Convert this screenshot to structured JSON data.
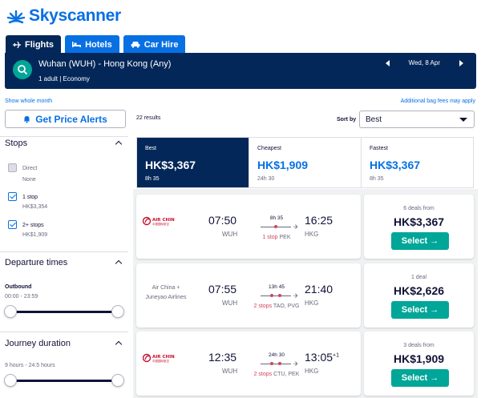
{
  "brand": {
    "name": "Skyscanner",
    "color": "#0770e3"
  },
  "tabs": [
    {
      "label": "Flights",
      "icon": "plane-icon",
      "active": true
    },
    {
      "label": "Hotels",
      "icon": "bed-icon",
      "active": false
    },
    {
      "label": "Car Hire",
      "icon": "car-icon",
      "active": false
    }
  ],
  "search": {
    "route": "Wuhan (WUH) - Hong Kong (Any)",
    "travellers": "1 adult | Economy",
    "date": "Wed, 8 Apr"
  },
  "links": {
    "show_month": "Show whole month",
    "bag_fees": "Additional bag fees may apply"
  },
  "price_alert": {
    "label": "Get Price Alerts",
    "icon": "bell-icon"
  },
  "filters": {
    "stops": {
      "title": "Stops",
      "options": [
        {
          "label": "Direct",
          "price": "None",
          "checked": false,
          "disabled": true
        },
        {
          "label": "1 stop",
          "price": "HK$3,354",
          "checked": true,
          "disabled": false
        },
        {
          "label": "2+ stops",
          "price": "HK$1,909",
          "checked": true,
          "disabled": false
        }
      ]
    },
    "departure": {
      "title": "Departure times",
      "subtitle": "Outbound",
      "range": "00:00 - 23:59"
    },
    "duration": {
      "title": "Journey duration",
      "range": "9 hours - 24.5 hours"
    }
  },
  "results": {
    "count": "22 results",
    "sort_label": "Sort by",
    "sort_value": "Best"
  },
  "sort_tabs": [
    {
      "label": "Best",
      "price": "HK$3,367",
      "duration": "8h 35",
      "active": true
    },
    {
      "label": "Cheapest",
      "price": "HK$1,909",
      "duration": "24h 30",
      "active": false
    },
    {
      "label": "Fastest",
      "price": "HK$3,367",
      "duration": "8h 35",
      "active": false
    }
  ],
  "flights": [
    {
      "airline": "Air China",
      "airline_logo": true,
      "dep_time": "07:50",
      "dep_code": "WUH",
      "arr_time": "16:25",
      "arr_day": "",
      "arr_code": "HKG",
      "duration": "8h 35",
      "stops": "1 stop",
      "via": "PEK",
      "deals": "6 deals from",
      "price": "HK$3,367",
      "select_label": "Select →"
    },
    {
      "airline": "Air China + Juneyao Airlines",
      "airline_line1": "Air China +",
      "airline_line2": "Juneyao Airlines",
      "airline_logo": false,
      "dep_time": "07:55",
      "dep_code": "WUH",
      "arr_time": "21:40",
      "arr_day": "",
      "arr_code": "HKG",
      "duration": "13h 45",
      "stops": "2 stops",
      "via": "TAO, PVG",
      "deals": "1 deal",
      "price": "HK$2,626",
      "select_label": "Select →"
    },
    {
      "airline": "Air China",
      "airline_logo": true,
      "dep_time": "12:35",
      "dep_code": "WUH",
      "arr_time": "13:05",
      "arr_day": "+1",
      "arr_code": "HKG",
      "duration": "24h 30",
      "stops": "2 stops",
      "via": "CTU, PEK",
      "deals": "3 deals from",
      "price": "HK$1,909",
      "select_label": "Select →"
    }
  ]
}
